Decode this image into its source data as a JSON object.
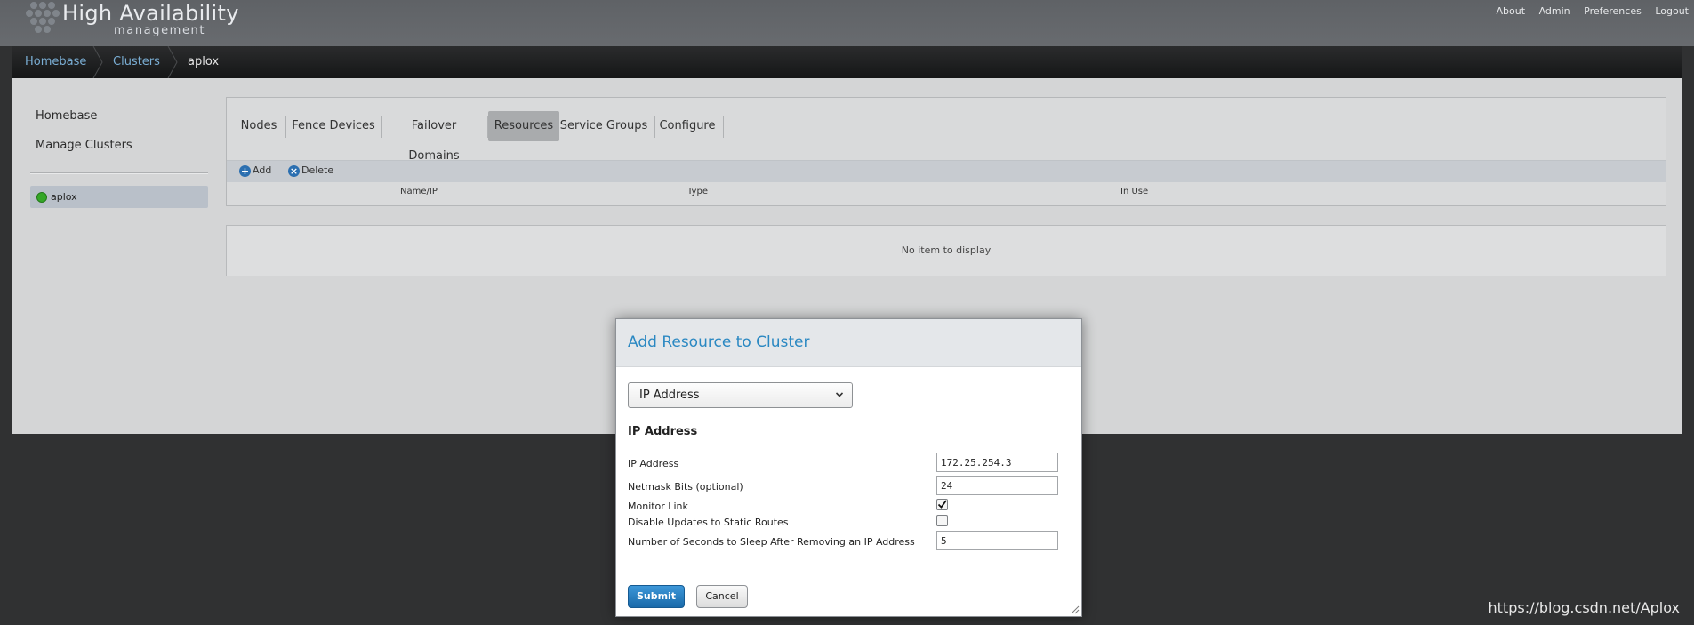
{
  "header": {
    "brand_line1": "High Availability",
    "brand_line2": "management",
    "links": [
      "About",
      "Admin",
      "Preferences",
      "Logout"
    ]
  },
  "breadcrumb": [
    "Homebase",
    "Clusters",
    "aplox"
  ],
  "sidebar": {
    "links": [
      "Homebase",
      "Manage Clusters"
    ],
    "cluster": {
      "name": "aplox",
      "status_color": "#35a728"
    }
  },
  "tabs": [
    "Nodes",
    "Fence Devices",
    "Failover Domains",
    "Resources",
    "Service Groups",
    "Configure"
  ],
  "active_tab": "Resources",
  "toolbar": {
    "add_label": "Add",
    "delete_label": "Delete"
  },
  "table": {
    "columns": [
      "Name/IP",
      "Type",
      "In Use"
    ],
    "empty_text": "No item to display"
  },
  "dialog": {
    "title": "Add Resource to Cluster",
    "resource_type": "IP Address",
    "section_title": "IP Address",
    "fields": [
      {
        "label": "IP Address",
        "value": "172.25.254.3"
      },
      {
        "label": "Netmask Bits (optional)",
        "value": "24"
      },
      {
        "label": "Monitor Link",
        "checked": true
      },
      {
        "label": "Disable Updates to Static Routes",
        "checked": false
      },
      {
        "label": "Number of Seconds to Sleep After Removing an IP Address",
        "value": "5"
      }
    ],
    "submit_label": "Submit",
    "cancel_label": "Cancel"
  },
  "watermark": "https://blog.csdn.net/Aplox",
  "colors": {
    "accent": "#2a88c2",
    "link": "#7aaed4",
    "submit": "#1f78bd"
  }
}
